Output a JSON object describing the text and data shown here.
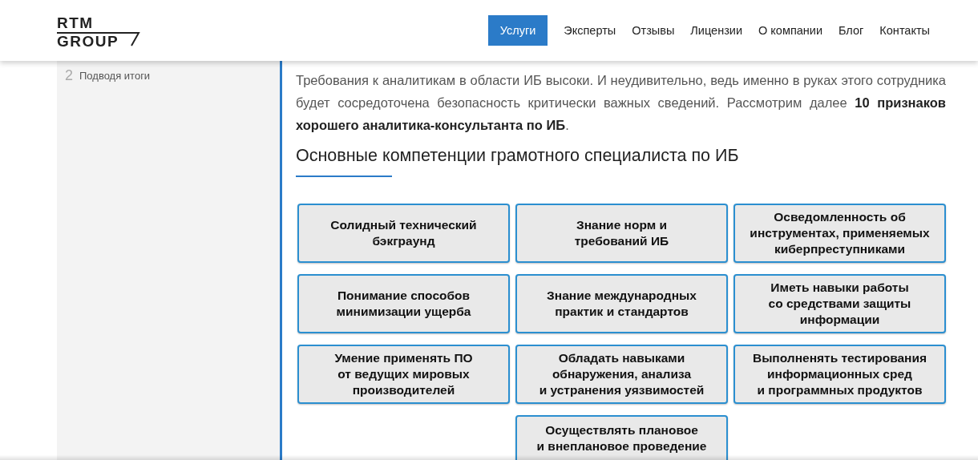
{
  "header": {
    "logo": {
      "top": "RTM",
      "bottom": "GROUP"
    },
    "nav": [
      {
        "label": "Услуги",
        "selected": true
      },
      {
        "label": "Эксперты",
        "selected": false
      },
      {
        "label": "Отзывы",
        "selected": false
      },
      {
        "label": "Лицензии",
        "selected": false
      },
      {
        "label": "О компании",
        "selected": false
      },
      {
        "label": "Блог",
        "selected": false
      },
      {
        "label": "Контакты",
        "selected": false
      }
    ]
  },
  "sidebar": {
    "items": [
      {
        "number": "2",
        "label": "Подводя итоги"
      }
    ]
  },
  "article": {
    "intro": "Требования к аналитикам в области ИБ высоки. И неудивительно, ведь именно в руках этого сотрудника будет сосредоточена безопасность критически важных сведений. Рассмотрим далее **10 признаков хорошего аналитика-консультанта по ИБ**.",
    "heading": "Основные компетенции грамотного специалиста по ИБ",
    "cards": [
      {
        "lines": [
          "Солидный технический",
          "бэкграунд"
        ]
      },
      {
        "lines": [
          "Знание норм и",
          "требований ИБ"
        ]
      },
      {
        "lines": [
          "Осведомленность об",
          "инструментах, применяемых",
          "киберпреступниками"
        ]
      },
      {
        "lines": [
          "Понимание способов",
          "минимизации ущерба"
        ]
      },
      {
        "lines": [
          "Знание международных",
          "практик и стандартов"
        ]
      },
      {
        "lines": [
          "Иметь навыки работы",
          "со средствами защиты",
          "информации"
        ]
      },
      {
        "lines": [
          "Умение применять ПО",
          "от ведущих мировых",
          "производителей"
        ]
      },
      {
        "lines": [
          "Обладать навыками",
          "обнаружения, анализа",
          "и устранения уязвимостей"
        ]
      },
      {
        "lines": [
          "Выполненять тестирования",
          "информационных сред",
          "и программных продуктов"
        ]
      },
      {
        "lines": [
          "Осуществлять плановое",
          "и внеплановое проведение"
        ]
      }
    ]
  }
}
